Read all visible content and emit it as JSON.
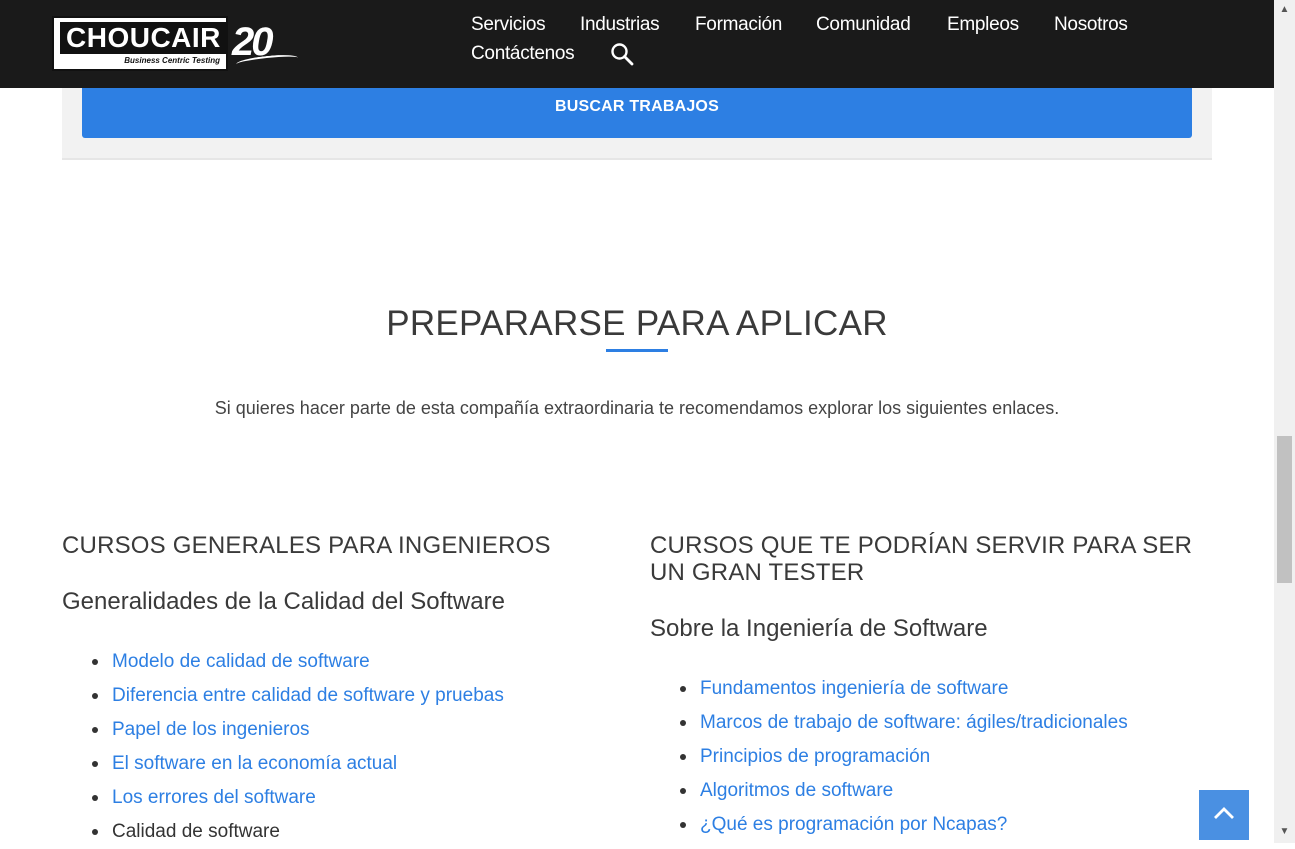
{
  "header": {
    "logo_text": "CHOUCAIR",
    "logo_tagline": "Business Centric Testing",
    "anniversary": "20",
    "nav": [
      "Servicios",
      "Industrias",
      "Formación",
      "Comunidad",
      "Empleos",
      "Nosotros",
      "Contáctenos"
    ]
  },
  "search_panel": {
    "button_label": "BUSCAR TRABAJOS"
  },
  "section": {
    "title": "PREPARARSE PARA APLICAR",
    "intro": "Si quieres hacer parte de esta compañía extraordinaria te recomendamos explorar los siguientes enlaces."
  },
  "left_column": {
    "heading": "CURSOS GENERALES PARA INGENIEROS",
    "subheading": "Generalidades de la Calidad del Software",
    "links": [
      "Modelo de calidad de software",
      "Diferencia entre calidad de software y pruebas",
      "Papel de los ingenieros",
      "El software en la economía actual",
      "Los errores del software",
      "Calidad de software"
    ]
  },
  "right_column": {
    "heading_line1": "CURSOS QUE TE PODRÍAN SERVIR PARA SER",
    "heading_line2": "UN GRAN TESTER",
    "subheading": "Sobre la Ingeniería de Software",
    "links": [
      "Fundamentos ingeniería de software",
      "Marcos de trabajo de software: ágiles/tradicionales",
      "Principios de programación",
      "Algoritmos de software",
      "¿Qué es programación por Ncapas?"
    ]
  },
  "colors": {
    "accent": "#2d7fe3",
    "header_bg": "#1a1a1a",
    "to_top_bg": "#4a90e2"
  },
  "icons": {
    "search": "search-icon",
    "to_top": "chevron-up-icon"
  }
}
